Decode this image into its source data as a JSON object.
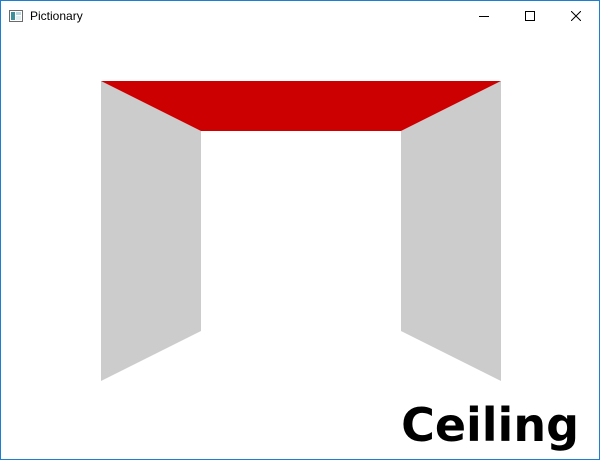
{
  "window": {
    "title": "Pictionary",
    "controls": {
      "minimize_icon": "minimize-icon",
      "maximize_icon": "maximize-icon",
      "close_icon": "close-icon"
    },
    "border_color": "#1e7fd0"
  },
  "scene": {
    "answer_label": "Ceiling",
    "colors": {
      "ceiling": "#cc0000",
      "walls": "#cccccc",
      "background": "#ffffff"
    }
  }
}
